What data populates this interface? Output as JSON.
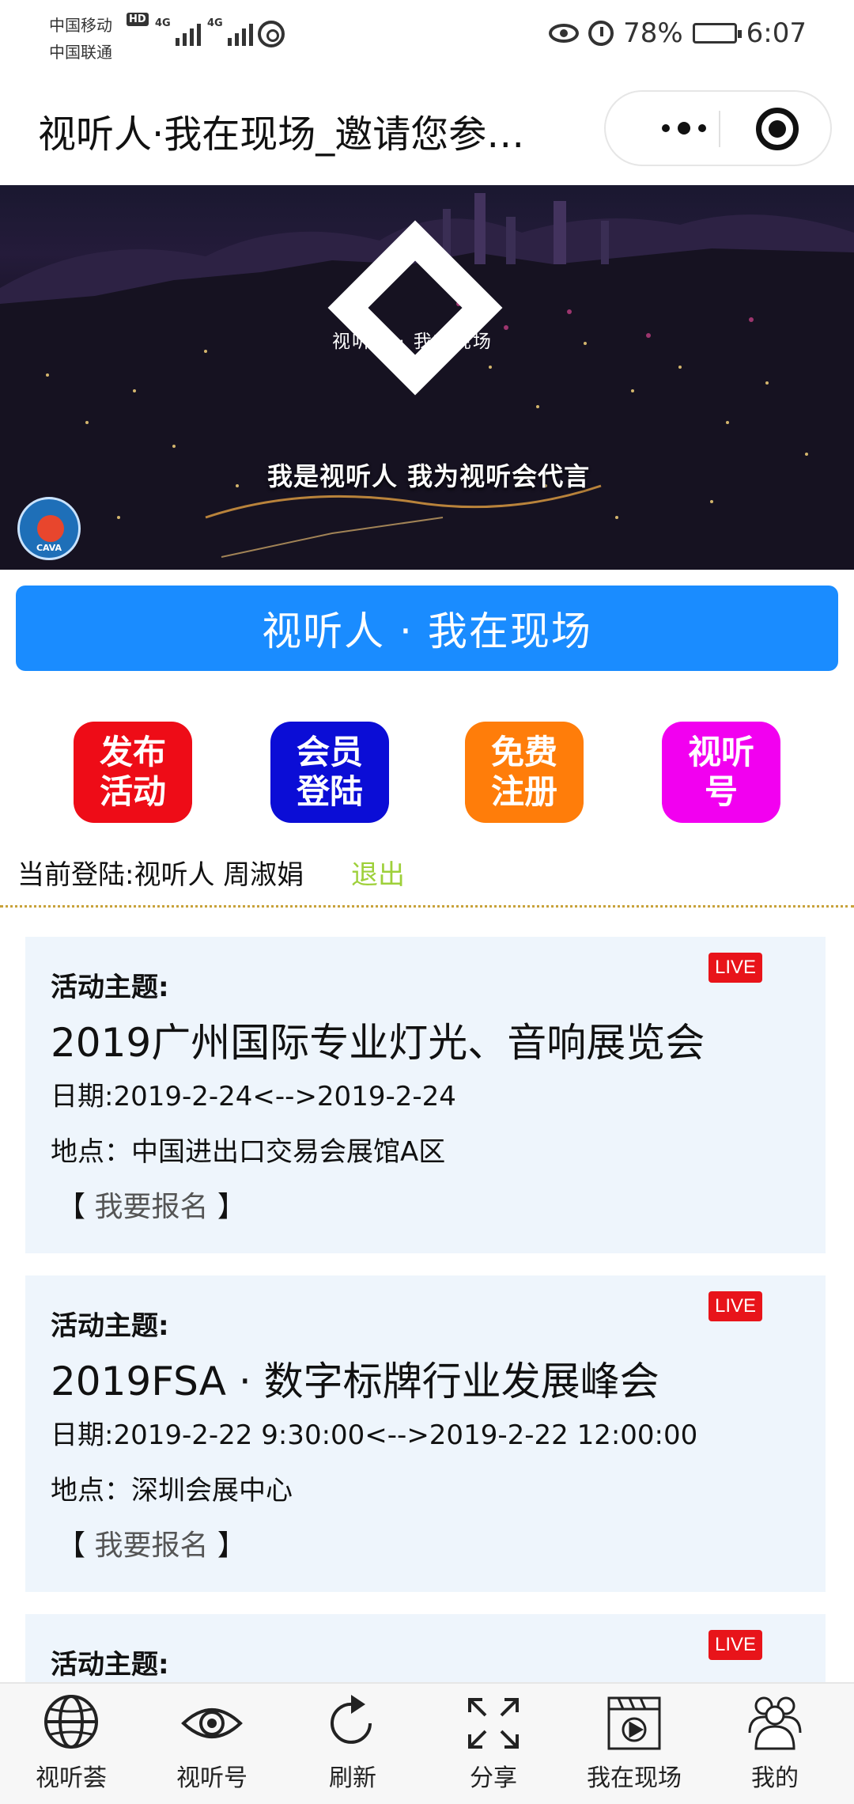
{
  "status_bar": {
    "carrier1": "中国移动",
    "carrier2": "中国联通",
    "hd": "HD",
    "net1": "4G",
    "net2": "4G",
    "battery": "78%",
    "time": "6:07"
  },
  "navbar": {
    "title": "视听人·我在现场_邀请您参…"
  },
  "banner": {
    "logo_text": "视听人 · 我在现场",
    "slogan": "我是视听人 我为视听会代言",
    "badge_text": "CAVA"
  },
  "primary_button": "视听人 · 我在现场",
  "actions": [
    {
      "line1": "发布",
      "line2": "活动",
      "color": "#ee0c17"
    },
    {
      "line1": "会员",
      "line2": "登陆",
      "color": "#0b0dd6"
    },
    {
      "line1": "免费",
      "line2": "注册",
      "color": "#ff7d0a"
    },
    {
      "line1": "视听",
      "line2": "号",
      "color": "#f200f0"
    }
  ],
  "login": {
    "text": "当前登陆:视听人 周淑娟",
    "logout": "退出"
  },
  "events": [
    {
      "label": "活动主题:",
      "title": "2019广州国际专业灯光、音响展览会",
      "date": "日期:2019-2-24<-->2019-2-24",
      "place": "地点：中国进出口交易会展馆A区",
      "signup": "我要报名",
      "badge": "LIVE"
    },
    {
      "label": "活动主题:",
      "title": "2019FSA · 数字标牌行业发展峰会",
      "date": "日期:2019-2-22 9:30:00<-->2019-2-22 12:00:00",
      "place": "地点：深圳会展中心",
      "signup": "我要报名",
      "badge": "LIVE"
    },
    {
      "label": "活动主题:",
      "badge": "LIVE"
    }
  ],
  "tabs": [
    {
      "label": "视听荟",
      "icon": "globe-icon"
    },
    {
      "label": "视听号",
      "icon": "eye-icon"
    },
    {
      "label": "刷新",
      "icon": "refresh-icon"
    },
    {
      "label": "分享",
      "icon": "share-arrows-icon"
    },
    {
      "label": "我在现场",
      "icon": "clapperboard-icon"
    },
    {
      "label": "我的",
      "icon": "people-icon"
    }
  ],
  "colors": {
    "primary_blue": "#1a8cff",
    "live_red": "#e8141a",
    "logout_green": "#9ed03a",
    "card_bg": "#eef5fc"
  }
}
